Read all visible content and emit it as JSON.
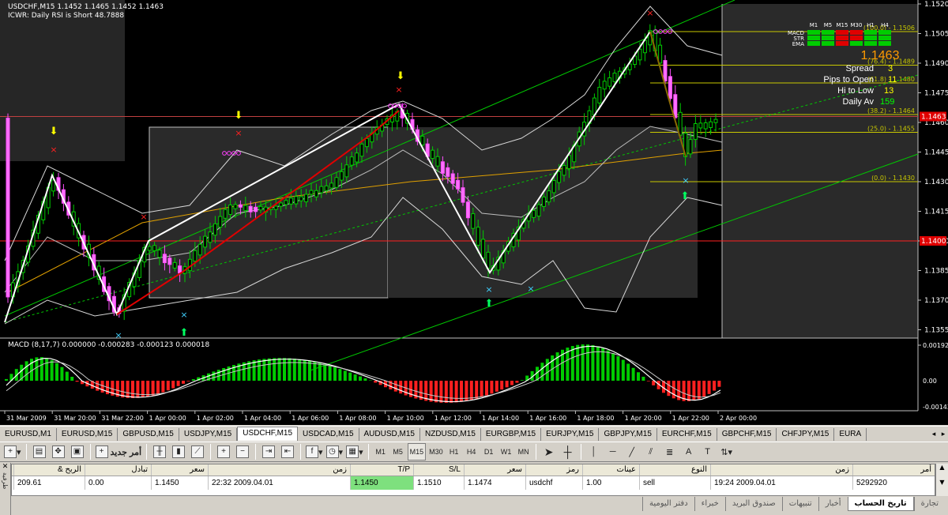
{
  "chart": {
    "symbol_line": "USDCHF,M15  1.1452 1.1465 1.1452 1.1463",
    "indicator_line": "ICWR: Daily RSI is Short 48.7888",
    "price_axis": [
      "1.1520",
      "1.1505",
      "1.1490",
      "1.1475",
      "1.1460",
      "1.1445",
      "1.1430",
      "1.1415",
      "1.1400",
      "1.1385",
      "1.1370",
      "1.1355"
    ],
    "current_price_tag": "1.1463",
    "red_line_tag": "1.1400",
    "fib_labels": [
      "(100.0) - 1.1506",
      "(76.4) - 1.1489",
      "(61.8) - 1.1480",
      "(38.2) - 1.1464",
      "(25.0) - 1.1455",
      "(0.0) - 1.1430"
    ],
    "panel": {
      "timeframes": [
        "M1",
        "M5",
        "M15",
        "M30",
        "H1",
        "H4"
      ],
      "rows": [
        "MACD",
        "STR",
        "EMA"
      ],
      "big_price": "1.1463",
      "spread_label": "Spread",
      "spread_value": "3",
      "pips_label": "Pips to Open",
      "pips_value": "11",
      "hilo_label": "Hi to Low",
      "hilo_value": "13",
      "daily_label": "Daily Av",
      "daily_value": "159"
    },
    "macd_label": "MACD (8,17,7) 0.000000 -0.000283 -0.000123 0.000018",
    "macd_axis": [
      "0.001924",
      "0.00",
      "-0.00143"
    ],
    "time_axis": [
      "31 Mar 2009",
      "31 Mar 20:00",
      "31 Mar 22:00",
      "1 Apr 00:00",
      "1 Apr 02:00",
      "1 Apr 04:00",
      "1 Apr 06:00",
      "1 Apr 08:00",
      "1 Apr 10:00",
      "1 Apr 12:00",
      "1 Apr 14:00",
      "1 Apr 16:00",
      "1 Apr 18:00",
      "1 Apr 20:00",
      "1 Apr 22:00",
      "2 Apr 00:00"
    ],
    "colors": {
      "bull": "#00cc00",
      "bear": "#ff4fff",
      "fib": "#c8c800",
      "channel": "#00c800",
      "zigzag": "#ffffff",
      "red": "#ff2020"
    }
  },
  "symbol_tabs": [
    "EURUSD,M1",
    "EURUSD,M15",
    "GBPUSD,M15",
    "USDJPY,M15",
    "USDCHF,M15",
    "USDCAD,M15",
    "AUDUSD,M15",
    "NZDUSD,M15",
    "EURGBP,M15",
    "EURJPY,M15",
    "GBPJPY,M15",
    "EURCHF,M15",
    "GBPCHF,M15",
    "CHFJPY,M15",
    "EURA"
  ],
  "active_tab": "USDCHF,M15",
  "toolbar": {
    "new_order": "أمر جديد",
    "timeframes": [
      "M1",
      "M5",
      "M15",
      "M30",
      "H1",
      "H4",
      "D1",
      "W1",
      "MN"
    ],
    "active_tf": "M15"
  },
  "terminal": {
    "headers": [
      "أمر",
      "زمن",
      "النوع",
      "عينات",
      "رمز",
      "سعر",
      "S/L",
      "T/P",
      "زمن",
      "سعر",
      "تبادل",
      "الربح &"
    ],
    "row": [
      "5292920",
      "2009.04.01 19:24",
      "sell",
      "1.00",
      "usdchf",
      "1.1474",
      "1.1510",
      "1.1450",
      "2009.04.01 22:32",
      "1.1450",
      "0.00",
      "209.61"
    ],
    "tabs": [
      "تجارة",
      "تاريخ الحساب",
      "أخبار",
      "تنبيهات",
      "صندوق البريد",
      "خبراء",
      "دفتر اليومية"
    ],
    "active_tab": "تاريخ الحساب",
    "side_label": "طرفية"
  }
}
